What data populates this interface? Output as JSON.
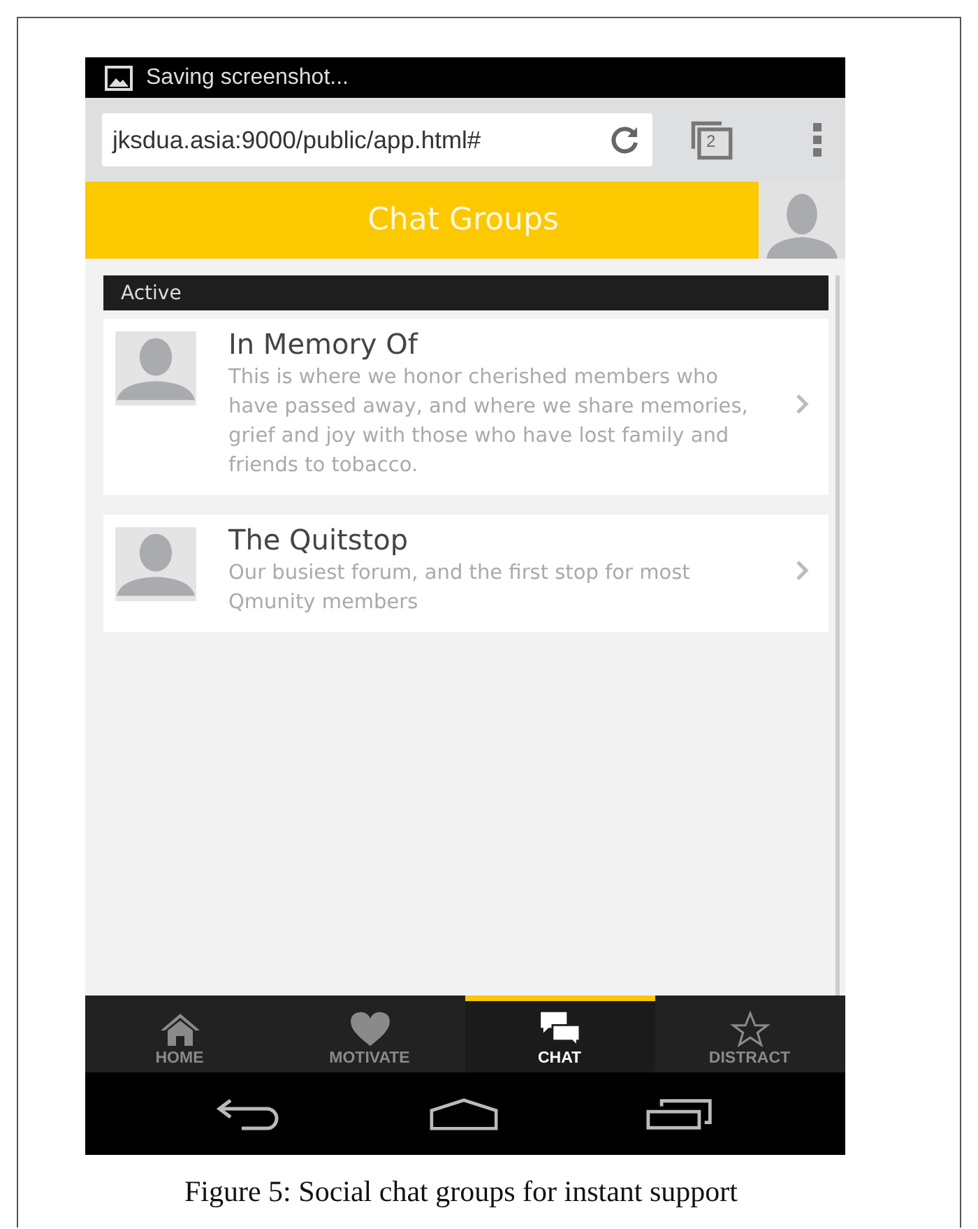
{
  "status_bar": {
    "notification": "Saving screenshot..."
  },
  "browser": {
    "url": "jksdua.asia:9000/public/app.html#",
    "tab_count": "2"
  },
  "header": {
    "title": "Chat Groups"
  },
  "section": {
    "label": "Active"
  },
  "groups": [
    {
      "name": "In Memory Of",
      "description": "This is where we honor cherished members who have passed away, and where we share memories, grief and joy with those who have lost family and friends to tobacco."
    },
    {
      "name": "The Quitstop",
      "description": "Our busiest forum, and the first stop for most Qmunity members"
    }
  ],
  "tabs": [
    {
      "label": "HOME",
      "kind": "home",
      "selected": false
    },
    {
      "label": "MOTIVATE",
      "kind": "heart",
      "selected": false
    },
    {
      "label": "CHAT",
      "kind": "chat",
      "selected": true
    },
    {
      "label": "DISTRACT",
      "kind": "star",
      "selected": false
    }
  ],
  "caption": "Figure 5: Social chat groups for instant support"
}
